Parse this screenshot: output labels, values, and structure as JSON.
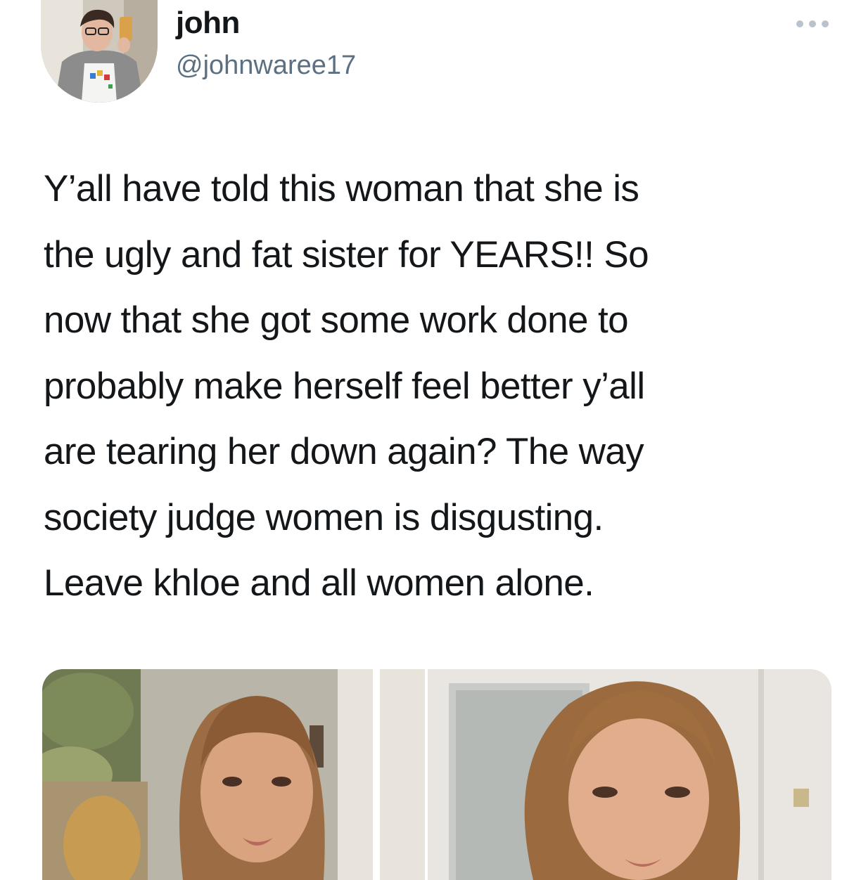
{
  "tweet": {
    "author": {
      "display_name": "john",
      "handle": "@johnwaree17",
      "avatar_icon": "profile-photo-avatar"
    },
    "more_icon": "ellipsis-icon",
    "text_lines": [
      "Y’all have told this woman that she is",
      "the ugly and fat sister for YEARS!! So",
      "now that she got some work done to",
      "probably make herself feel better y’all",
      "are tearing her down again? The way",
      "society judge women is disgusting.",
      "Leave khloe and all women alone."
    ],
    "media": {
      "images": [
        {
          "icon": "photo-woman-before"
        },
        {
          "icon": "photo-woman-after"
        }
      ]
    }
  },
  "colors": {
    "text_primary": "#14171a",
    "text_secondary": "#5b7083",
    "dots": "#b9c3cd",
    "background": "#ffffff"
  }
}
